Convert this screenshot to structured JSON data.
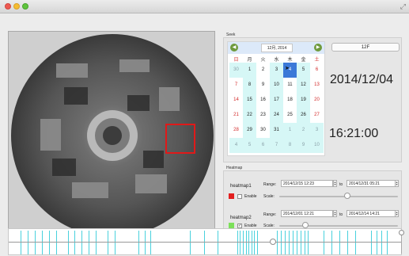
{
  "window": {
    "controls": [
      "close",
      "minimize",
      "zoom"
    ],
    "resize_icon": "resize-icon"
  },
  "seek": {
    "label": "Seek",
    "month_label": "12月, 2014",
    "weekdays": [
      "日",
      "月",
      "火",
      "水",
      "木",
      "金",
      "土"
    ],
    "rows": [
      [
        "30",
        "1",
        "2",
        "3",
        "4",
        "5",
        "6"
      ],
      [
        "7",
        "8",
        "9",
        "10",
        "11",
        "12",
        "13"
      ],
      [
        "14",
        "15",
        "16",
        "17",
        "18",
        "19",
        "20"
      ],
      [
        "21",
        "22",
        "23",
        "24",
        "25",
        "26",
        "27"
      ],
      [
        "28",
        "29",
        "30",
        "31",
        "1",
        "2",
        "3"
      ],
      [
        "4",
        "5",
        "6",
        "7",
        "8",
        "9",
        "10"
      ]
    ],
    "selected_day": "4",
    "level_button": "12F",
    "date_display": "2014/12/04",
    "time_display": "16:21:00"
  },
  "heatmap": {
    "label": "Heatmap",
    "range_label": "Range:",
    "to_label": "to",
    "scale_label": "Scale:",
    "enable_label": "Enable",
    "items": [
      {
        "name": "heatmap1",
        "from": "2014/12/15 12:23",
        "to": "2014/12/31 05:21",
        "color": "#e21f1f",
        "enabled": false,
        "scale": 0.57
      },
      {
        "name": "heatmap2",
        "from": "2014/12/01 12:21",
        "to": "2014/12/14 14:21",
        "color": "#7ce05a",
        "enabled": true,
        "scale": 0.22
      }
    ]
  },
  "timeline": {
    "playhead": 0.67,
    "scroll": 0.0
  },
  "colors": {
    "accent": "#3b79d8",
    "tick": "#49d1dd",
    "weekend": "#d32b2b",
    "roi": "#e01919"
  }
}
